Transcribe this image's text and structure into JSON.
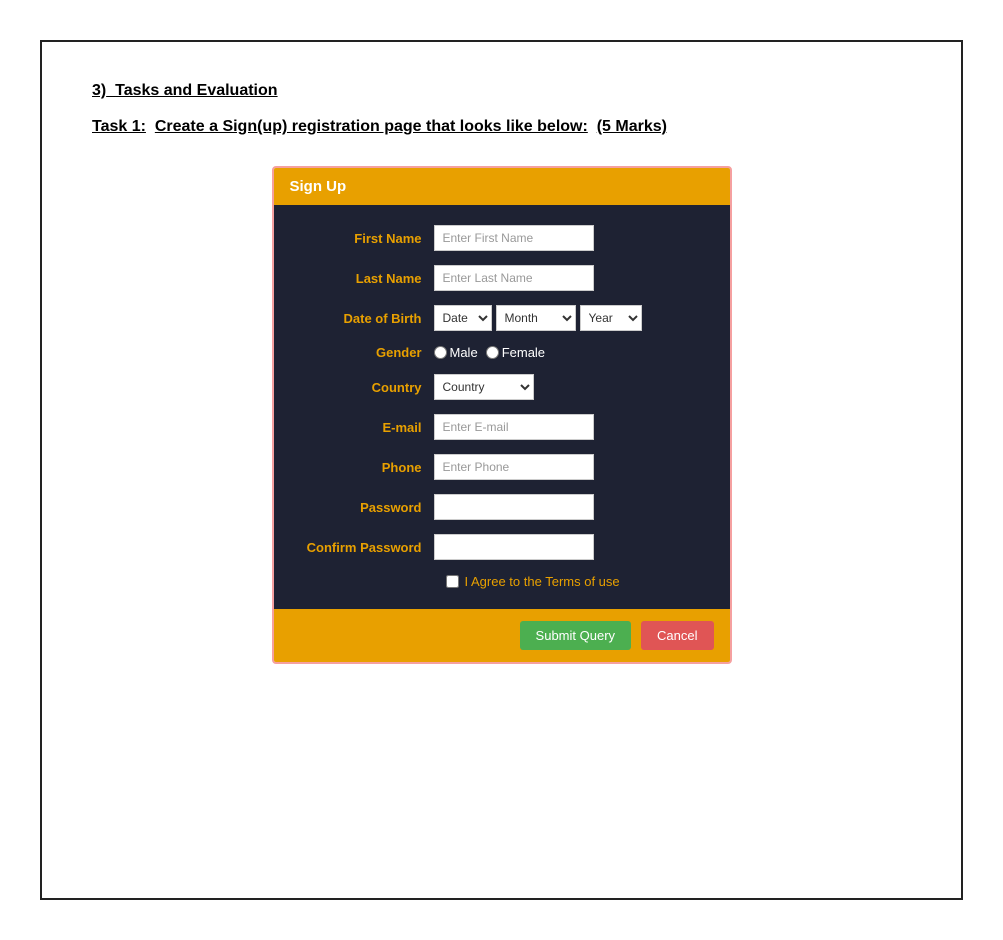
{
  "page": {
    "section_number": "3)",
    "section_title": "Tasks and Evaluation",
    "task_label": "Task 1:",
    "task_description": "Create a Sign(up) registration page that looks like below:",
    "task_marks": "(5 Marks)"
  },
  "form": {
    "title": "Sign Up",
    "fields": {
      "first_name_label": "First Name",
      "first_name_placeholder": "Enter First Name",
      "last_name_label": "Last Name",
      "last_name_placeholder": "Enter Last Name",
      "dob_label": "Date of Birth",
      "dob_date_option": "Date",
      "dob_month_option": "Month",
      "dob_year_option": "Year",
      "gender_label": "Gender",
      "gender_male": "Male",
      "gender_female": "Female",
      "country_label": "Country",
      "country_option": "Country",
      "email_label": "E-mail",
      "email_placeholder": "Enter E-mail",
      "phone_label": "Phone",
      "phone_placeholder": "Enter Phone",
      "password_label": "Password",
      "confirm_password_label": "Confirm Password",
      "terms_text": "I Agree to the Terms of use",
      "submit_button": "Submit Query",
      "cancel_button": "Cancel"
    }
  }
}
